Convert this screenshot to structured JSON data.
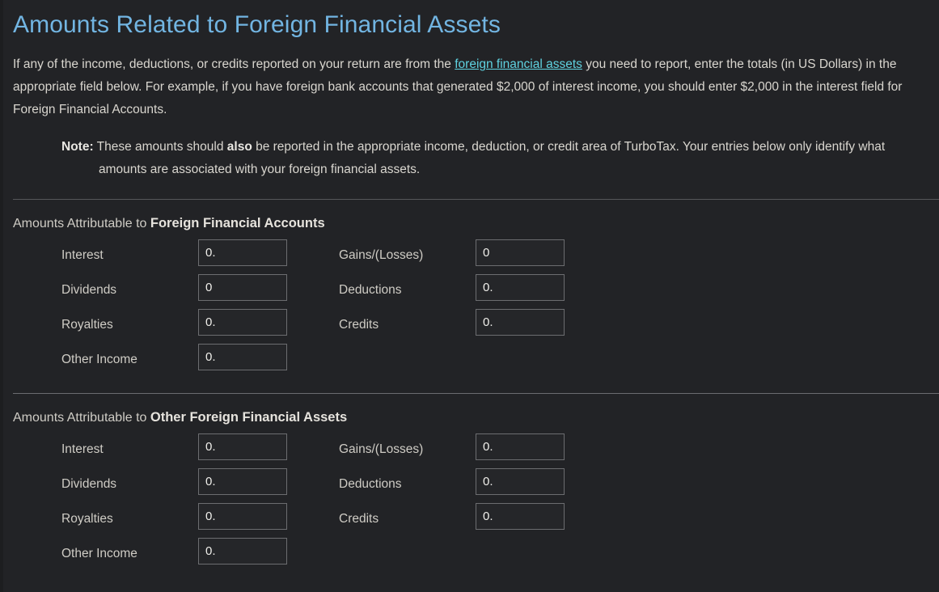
{
  "page": {
    "title": "Amounts Related to Foreign Financial Assets",
    "background_color": "#222326",
    "title_color": "#72b5e2",
    "link_color": "#5fd2e0",
    "text_color": "#d9d6cf"
  },
  "intro": {
    "part1": "If any of the income, deductions, or credits reported on your return are from the ",
    "link_text": "foreign financial assets",
    "part2": " you need to report, enter the totals (in US Dollars) in the appropriate field below. For example, if you have foreign bank accounts that generated $2,000 of interest income, you should enter $2,000 in the interest field for Foreign Financial Accounts."
  },
  "note": {
    "label": "Note:",
    "part1": " These amounts should ",
    "emphasis": "also",
    "part2": " be reported in the appropriate income, deduction, or credit area of TurboTax. Your entries below only identify what amounts are associated with your foreign financial assets."
  },
  "sections": [
    {
      "heading_prefix": "Amounts Attributable to ",
      "heading_strong": "Foreign Financial Accounts",
      "left_fields": [
        {
          "label": "Interest",
          "value": "0."
        },
        {
          "label": "Dividends",
          "value": "0"
        },
        {
          "label": "Royalties",
          "value": "0."
        },
        {
          "label": "Other Income",
          "value": "0."
        }
      ],
      "right_fields": [
        {
          "label": "Gains/(Losses)",
          "value": "0"
        },
        {
          "label": "Deductions",
          "value": "0."
        },
        {
          "label": "Credits",
          "value": "0."
        }
      ]
    },
    {
      "heading_prefix": "Amounts Attributable to ",
      "heading_strong": "Other Foreign Financial Assets",
      "left_fields": [
        {
          "label": "Interest",
          "value": "0."
        },
        {
          "label": "Dividends",
          "value": "0."
        },
        {
          "label": "Royalties",
          "value": "0."
        },
        {
          "label": "Other Income",
          "value": "0."
        }
      ],
      "right_fields": [
        {
          "label": "Gains/(Losses)",
          "value": "0."
        },
        {
          "label": "Deductions",
          "value": "0."
        },
        {
          "label": "Credits",
          "value": "0."
        }
      ]
    }
  ]
}
